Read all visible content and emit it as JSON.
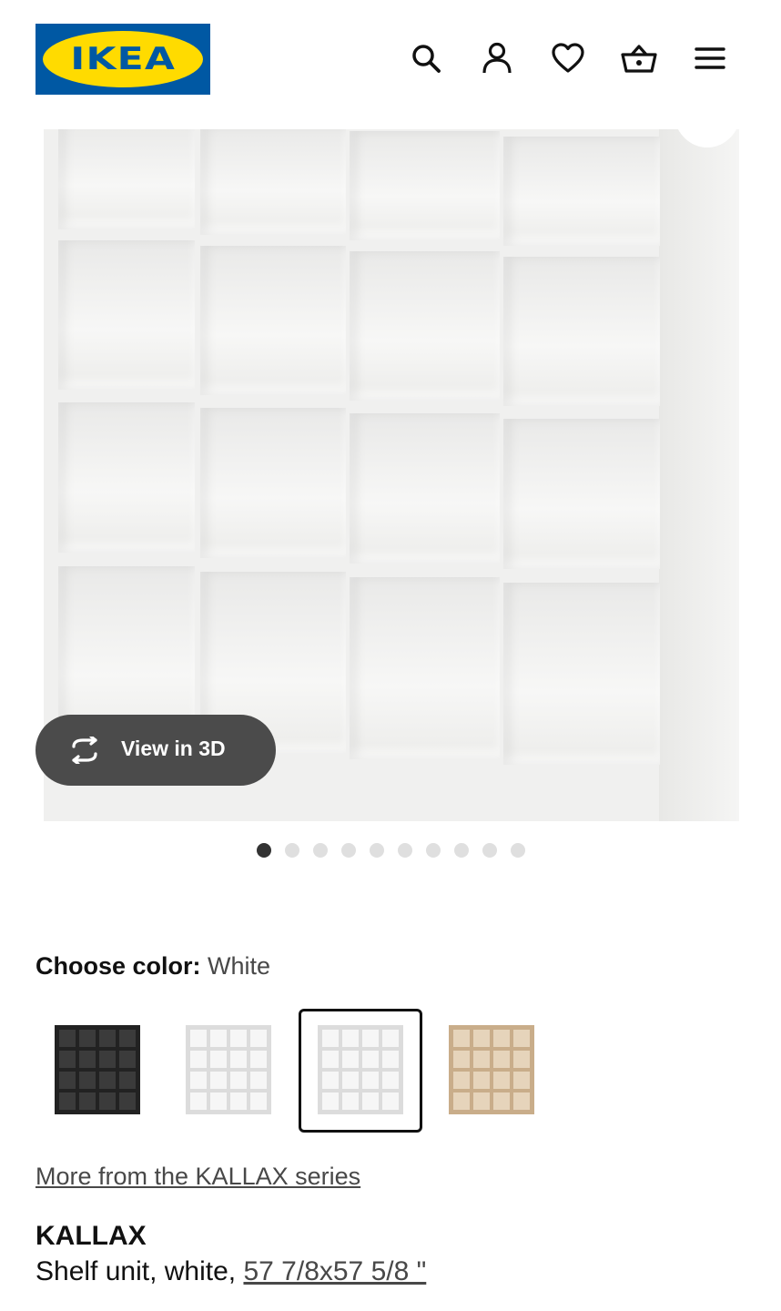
{
  "header": {
    "logo_text": "IKEA",
    "icons": [
      "search-icon",
      "profile-icon",
      "heart-icon",
      "basket-icon",
      "menu-icon"
    ]
  },
  "gallery": {
    "view_3d_label": "View in 3D",
    "image_count": 10,
    "active_index": 0
  },
  "color_picker": {
    "label": "Choose color:",
    "selected_value": "White",
    "swatches": [
      {
        "name": "black-brown",
        "color": "#2a2a2a"
      },
      {
        "name": "white",
        "color": "#f4f4f4"
      },
      {
        "name": "white",
        "color": "#f4f4f4",
        "selected": true
      },
      {
        "name": "white stained oak effect",
        "color": "#d8c3a5"
      }
    ]
  },
  "series_link": "More from the KALLAX series",
  "product": {
    "name": "KALLAX",
    "description": "Shelf unit, white,",
    "size": "57 7/8x57 5/8 \""
  },
  "colors": {
    "brand_blue": "#0058a3",
    "brand_yellow": "#ffdb00",
    "pill_bg": "#4b4b4b"
  }
}
